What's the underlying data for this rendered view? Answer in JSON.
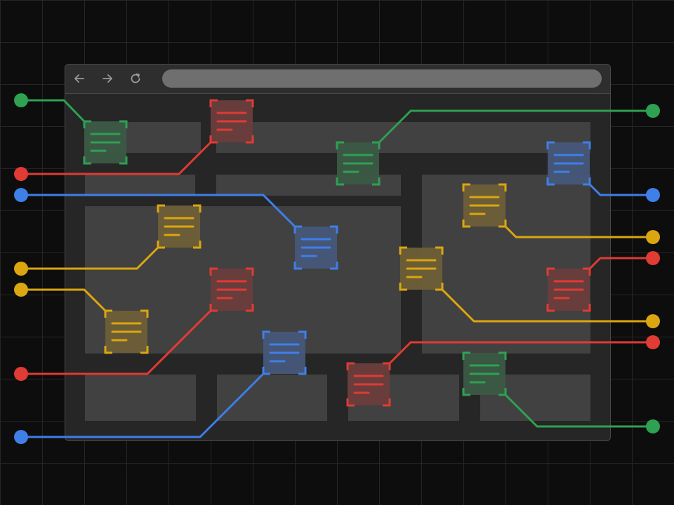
{
  "browser": {
    "address": "",
    "icons": [
      "back-arrow-icon",
      "forward-arrow-icon",
      "reload-icon"
    ]
  },
  "colors": {
    "green": "#2ea152",
    "red": "#e03b34",
    "blue": "#3f7fe8",
    "yellow": "#dba60f",
    "background": "#0d0d0d",
    "window": "#2a2a2a",
    "block": "#414141"
  },
  "annotations": [
    {
      "id": "a1",
      "color": "green"
    },
    {
      "id": "a2",
      "color": "red"
    },
    {
      "id": "a3",
      "color": "blue"
    },
    {
      "id": "a4",
      "color": "yellow"
    },
    {
      "id": "a5",
      "color": "yellow"
    },
    {
      "id": "a6",
      "color": "yellow"
    },
    {
      "id": "a7",
      "color": "red"
    },
    {
      "id": "a8",
      "color": "blue"
    },
    {
      "id": "a9",
      "color": "green"
    },
    {
      "id": "a10",
      "color": "red"
    },
    {
      "id": "a11",
      "color": "blue"
    },
    {
      "id": "a12",
      "color": "green"
    },
    {
      "id": "a13",
      "color": "yellow"
    },
    {
      "id": "a14",
      "color": "yellow"
    },
    {
      "id": "a15",
      "color": "red"
    },
    {
      "id": "a16",
      "color": "yellow"
    },
    {
      "id": "a17",
      "color": "red"
    },
    {
      "id": "a18",
      "color": "green"
    }
  ]
}
